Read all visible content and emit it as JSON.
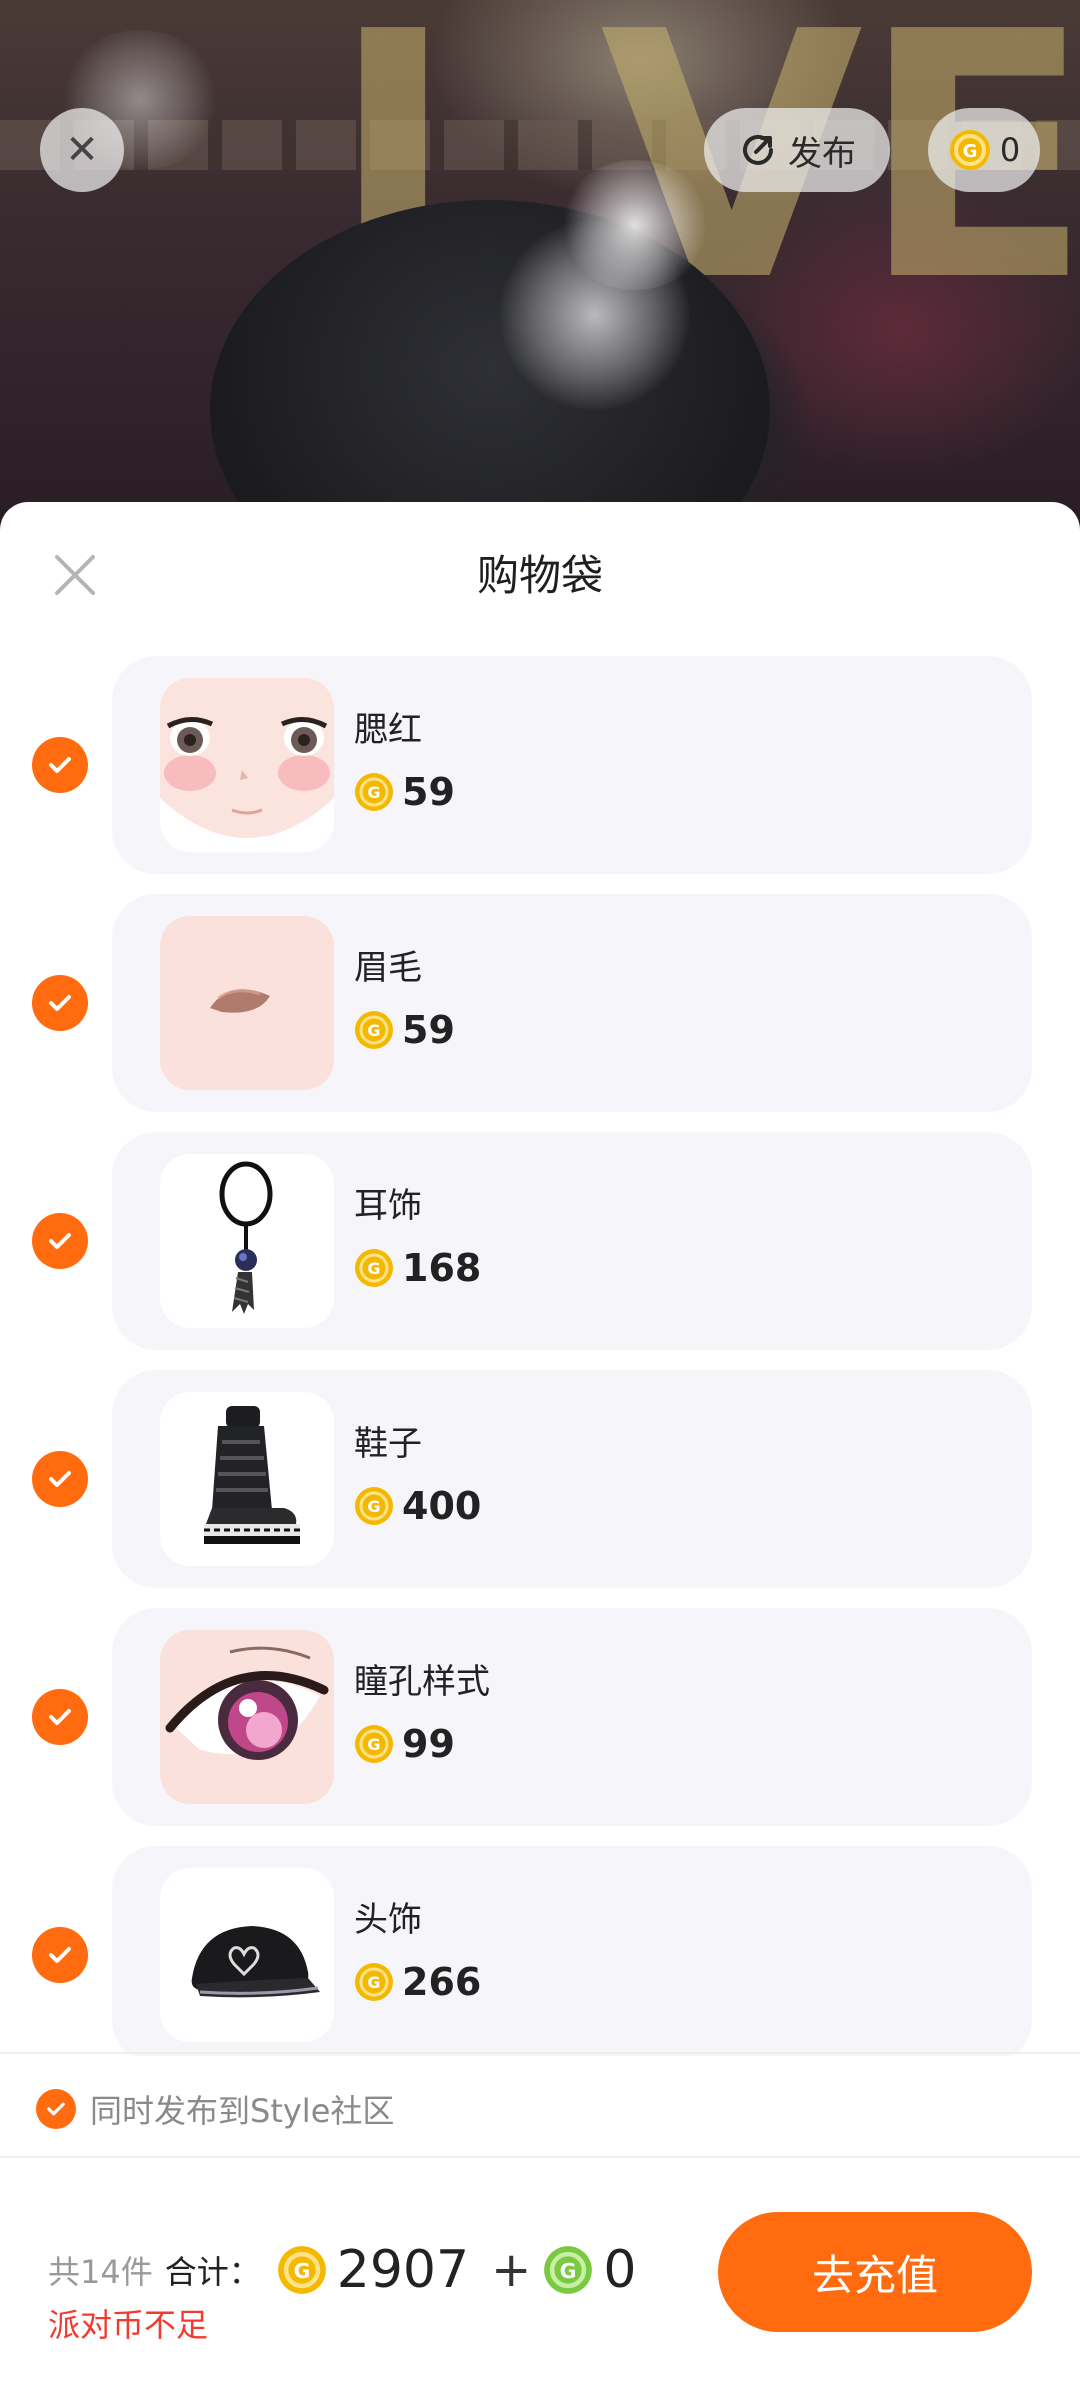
{
  "top_bar": {
    "publish_label": "发布",
    "coin_balance": "0"
  },
  "sheet": {
    "title": "购物袋",
    "items": [
      {
        "name": "腮红",
        "price": "59",
        "checked": true
      },
      {
        "name": "眉毛",
        "price": "59",
        "checked": true
      },
      {
        "name": "耳饰",
        "price": "168",
        "checked": true
      },
      {
        "name": "鞋子",
        "price": "400",
        "checked": true
      },
      {
        "name": "瞳孔样式",
        "price": "99",
        "checked": true
      },
      {
        "name": "头饰",
        "price": "266",
        "checked": true
      }
    ],
    "publish_to_community_label": "同时发布到Style社区",
    "publish_to_community_checked": true
  },
  "footer": {
    "item_count": "共14件",
    "total_label": "合计：",
    "gold_total": "2907",
    "plus": "+",
    "green_total": "0",
    "warning": "派对币不足",
    "recharge_button": "去充值"
  },
  "colors": {
    "accent": "#ff6b0e",
    "warning": "#f23b2e",
    "gold_coin": "#f5b800",
    "green_coin": "#7ac943"
  },
  "icons": [
    "close-icon",
    "publish-icon",
    "gold-coin-icon",
    "green-coin-icon",
    "check-icon"
  ]
}
